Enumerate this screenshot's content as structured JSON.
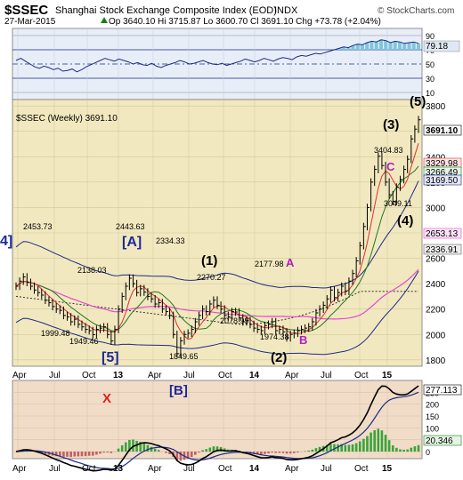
{
  "header": {
    "symbol": "$SSEC",
    "name": "Shanghai Stock Exchange Composite Index (EOD)",
    "exchange": "INDX",
    "date": "27-Mar-2015",
    "ohlc": "Op 3640.10  Hi 3715.87  Lo 3600.70  Cl 3691.10  Chg +73.78 (+2.04%)",
    "ohlc_icon": "up-triangle-icon",
    "watermark": "© StockCharts.com"
  },
  "colors": {
    "rsi_bg": "#e8eef8",
    "price_bg": "#f2e8bf",
    "macd_bg": "#f1dcc8",
    "blue_line": "#1c2a8a",
    "price_line": "#000000",
    "ma_red": "#e03030",
    "ma_green": "#1f7a1f",
    "ma_pink": "#e04bd0",
    "rsi_fill": "#7fc6dc",
    "hist_green": "#3aa33a",
    "label_purple": "#b020c0",
    "label_blue": "#1c2a9a",
    "label_red": "#e02020"
  },
  "rsi": {
    "ticks": [
      "90",
      "70",
      "50",
      "30",
      "10"
    ],
    "value_label": "79.18",
    "series": [
      55,
      58,
      54,
      50,
      46,
      44,
      47,
      45,
      42,
      44,
      40,
      41,
      43,
      39,
      42,
      46,
      49,
      52,
      55,
      58,
      56,
      54,
      57,
      55,
      53,
      50,
      52,
      49,
      48,
      51,
      47,
      45,
      48,
      50,
      52,
      55,
      53,
      50,
      51,
      53,
      55,
      52,
      50,
      49,
      51,
      48,
      50,
      52,
      54,
      57,
      55,
      53,
      55,
      58,
      56,
      54,
      57,
      59,
      58,
      56,
      60,
      62,
      61,
      63,
      65,
      64,
      66,
      68,
      70,
      72,
      74,
      73,
      76,
      78,
      77,
      80,
      82,
      81,
      84,
      83,
      80,
      82,
      81,
      79,
      80,
      81,
      79.18
    ]
  },
  "price": {
    "title": "$SSEC (Weekly) 3691.10",
    "y_ticks": [
      "3800",
      "3600",
      "3400",
      "3200",
      "3000",
      "2800",
      "2600",
      "2400",
      "2200",
      "2000",
      "1800"
    ],
    "annotations": [
      {
        "text": "4]",
        "color": "blue"
      },
      {
        "text": "[A]",
        "color": "blue"
      },
      {
        "text": "[5]",
        "color": "blue"
      },
      {
        "text": "(1)",
        "color": "black"
      },
      {
        "text": "(2)",
        "color": "black"
      },
      {
        "text": "(3)",
        "color": "black"
      },
      {
        "text": "(4)",
        "color": "black"
      },
      {
        "text": "(5)",
        "color": "black"
      },
      {
        "text": "A",
        "color": "purple"
      },
      {
        "text": "B",
        "color": "purple"
      },
      {
        "text": "C",
        "color": "purple"
      }
    ],
    "point_labels": [
      "2453.73",
      "2443.63",
      "2334.33",
      "2270.27",
      "2177.98",
      "2138.03",
      "1999.48",
      "1949.46",
      "1849.65",
      "2078.99",
      "1974.38",
      "3404.83",
      "3049.11"
    ],
    "right_labels": [
      "3691.10",
      "3329.98",
      "3266.49",
      "3169.50",
      "2653.13",
      "2336.91"
    ]
  },
  "macd": {
    "letter_x": "X",
    "label_b": "[B]",
    "y_ticks": [
      "250",
      "200",
      "150",
      "100",
      "50",
      "0"
    ],
    "labels": [
      "277.113",
      "20.346"
    ]
  },
  "x_axis_labels": [
    "Apr",
    "Jul",
    "Oct",
    "13",
    "Apr",
    "Jul",
    "Oct",
    "14",
    "Apr",
    "Jul",
    "Oct",
    "15"
  ],
  "chart_data": {
    "type": "line",
    "title": "$SSEC (Weekly) 3691.10",
    "xlabel": "",
    "ylabel": "",
    "ylim": [
      1750,
      3850
    ],
    "x_tick_labels": [
      "Apr",
      "Jul",
      "Oct",
      "13",
      "Apr",
      "Jul",
      "Oct",
      "14",
      "Apr",
      "Jul",
      "Oct",
      "15"
    ],
    "close": [
      2380,
      2420,
      2453,
      2410,
      2380,
      2350,
      2330,
      2310,
      2270,
      2250,
      2220,
      2200,
      2190,
      2150,
      2138,
      2100,
      2120,
      2080,
      2060,
      2040,
      2030,
      1999,
      2040,
      2050,
      2060,
      2000,
      1949,
      2040,
      2200,
      2300,
      2380,
      2443,
      2400,
      2330,
      2360,
      2334,
      2300,
      2280,
      2240,
      2250,
      2200,
      2180,
      2150,
      2000,
      1849,
      1950,
      2000,
      2010,
      2040,
      2100,
      2150,
      2200,
      2180,
      2240,
      2270,
      2230,
      2200,
      2150,
      2140,
      2180,
      2177,
      2130,
      2100,
      2110,
      2079,
      2050,
      2040,
      2030,
      2070,
      2080,
      2100,
      2030,
      2040,
      2020,
      1974,
      2000,
      2010,
      2030,
      2040,
      2050,
      2060,
      2100,
      2170,
      2200,
      2230,
      2280,
      2350,
      2290,
      2330,
      2380,
      2340,
      2420,
      2480,
      2580,
      2700,
      2850,
      3000,
      3200,
      3300,
      3404,
      3330,
      3200,
      3100,
      3049,
      3160,
      3220,
      3300,
      3380,
      3540,
      3617,
      3691
    ],
    "annotated_points": [
      {
        "label": "2453.73",
        "value": 2453.73
      },
      {
        "label": "2443.63",
        "value": 2443.63
      },
      {
        "label": "2334.33",
        "value": 2334.33
      },
      {
        "label": "2270.27",
        "value": 2270.27
      },
      {
        "label": "2177.98",
        "value": 2177.98
      },
      {
        "label": "2138.03",
        "value": 2138.03
      },
      {
        "label": "1999.48",
        "value": 1999.48
      },
      {
        "label": "1949.46",
        "value": 1949.46
      },
      {
        "label": "1849.65",
        "value": 1849.65
      },
      {
        "label": "2078.99",
        "value": 2078.99
      },
      {
        "label": "1974.38",
        "value": 1974.38
      },
      {
        "label": "3404.83",
        "value": 3404.83
      },
      {
        "label": "3049.11",
        "value": 3049.11
      }
    ],
    "last_values": {
      "close": 3691.1,
      "ma_red": 3329.98,
      "ma_green": 3266.49,
      "upper_blue": 3169.5,
      "ma_pink": 2653.13,
      "ma_dotted": 2336.91
    },
    "rsi_last": 79.18,
    "macd_last": [
      277.113,
      20.346
    ],
    "grid": true,
    "legend": "none"
  }
}
